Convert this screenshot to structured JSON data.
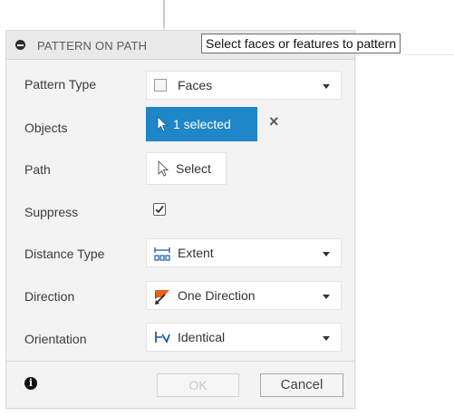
{
  "dialog": {
    "title": "PATTERN ON PATH",
    "tooltip": "Select faces or features to pattern"
  },
  "rows": {
    "pattern_type": {
      "label": "Pattern Type",
      "value": "Faces",
      "icon": "face-square-icon"
    },
    "objects": {
      "label": "Objects",
      "value": "1 selected",
      "icon": "cursor-arrow-icon",
      "clear": "×"
    },
    "path": {
      "label": "Path",
      "value": "Select",
      "icon": "cursor-arrow-icon"
    },
    "suppress": {
      "label": "Suppress",
      "checked": true
    },
    "distance_type": {
      "label": "Distance Type",
      "value": "Extent",
      "icon": "extent-icon"
    },
    "direction": {
      "label": "Direction",
      "value": "One Direction",
      "icon": "one-direction-icon"
    },
    "orientation": {
      "label": "Orientation",
      "value": "Identical",
      "icon": "identical-icon"
    }
  },
  "footer": {
    "ok_label": "OK",
    "cancel_label": "Cancel",
    "info": "i"
  },
  "colors": {
    "accent": "#1f86c8",
    "direction_orange": "#e8611a"
  }
}
